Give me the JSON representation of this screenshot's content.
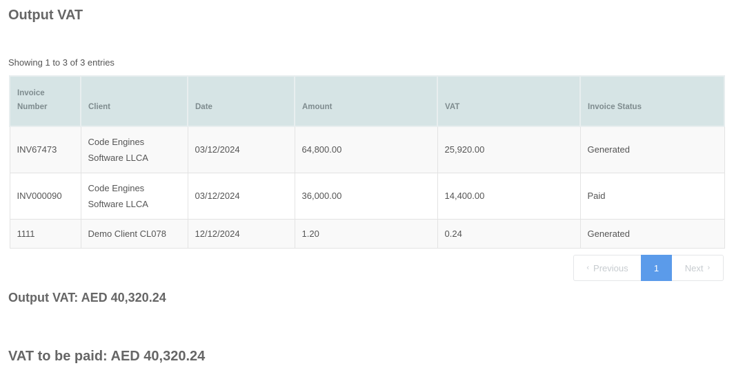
{
  "page": {
    "title": "Output VAT",
    "entries_info": "Showing 1 to 3 of 3 entries"
  },
  "table": {
    "headers": [
      "Invoice Number",
      "Client",
      "Date",
      "Amount",
      "VAT",
      "Invoice Status"
    ],
    "rows": [
      [
        "INV67473",
        "Code Engines Software LLCA",
        "03/12/2024",
        "64,800.00",
        "25,920.00",
        "Generated"
      ],
      [
        "INV000090",
        "Code Engines Software LLCA",
        "03/12/2024",
        "36,000.00",
        "14,400.00",
        "Paid"
      ],
      [
        "1111",
        "Demo Client CL078",
        "12/12/2024",
        "1.20",
        "0.24",
        "Generated"
      ]
    ]
  },
  "pagination": {
    "previous_label": "Previous",
    "current_page": "1",
    "next_label": "Next",
    "previous_icon": "chevron-left-icon",
    "next_icon": "chevron-right-icon"
  },
  "totals": {
    "output_vat": "Output VAT: AED 40,320.24",
    "vat_to_be_paid": "VAT to be paid: AED 40,320.24"
  },
  "colors": {
    "header_bg": "#d6e4e5",
    "accent": "#5b9bea"
  }
}
